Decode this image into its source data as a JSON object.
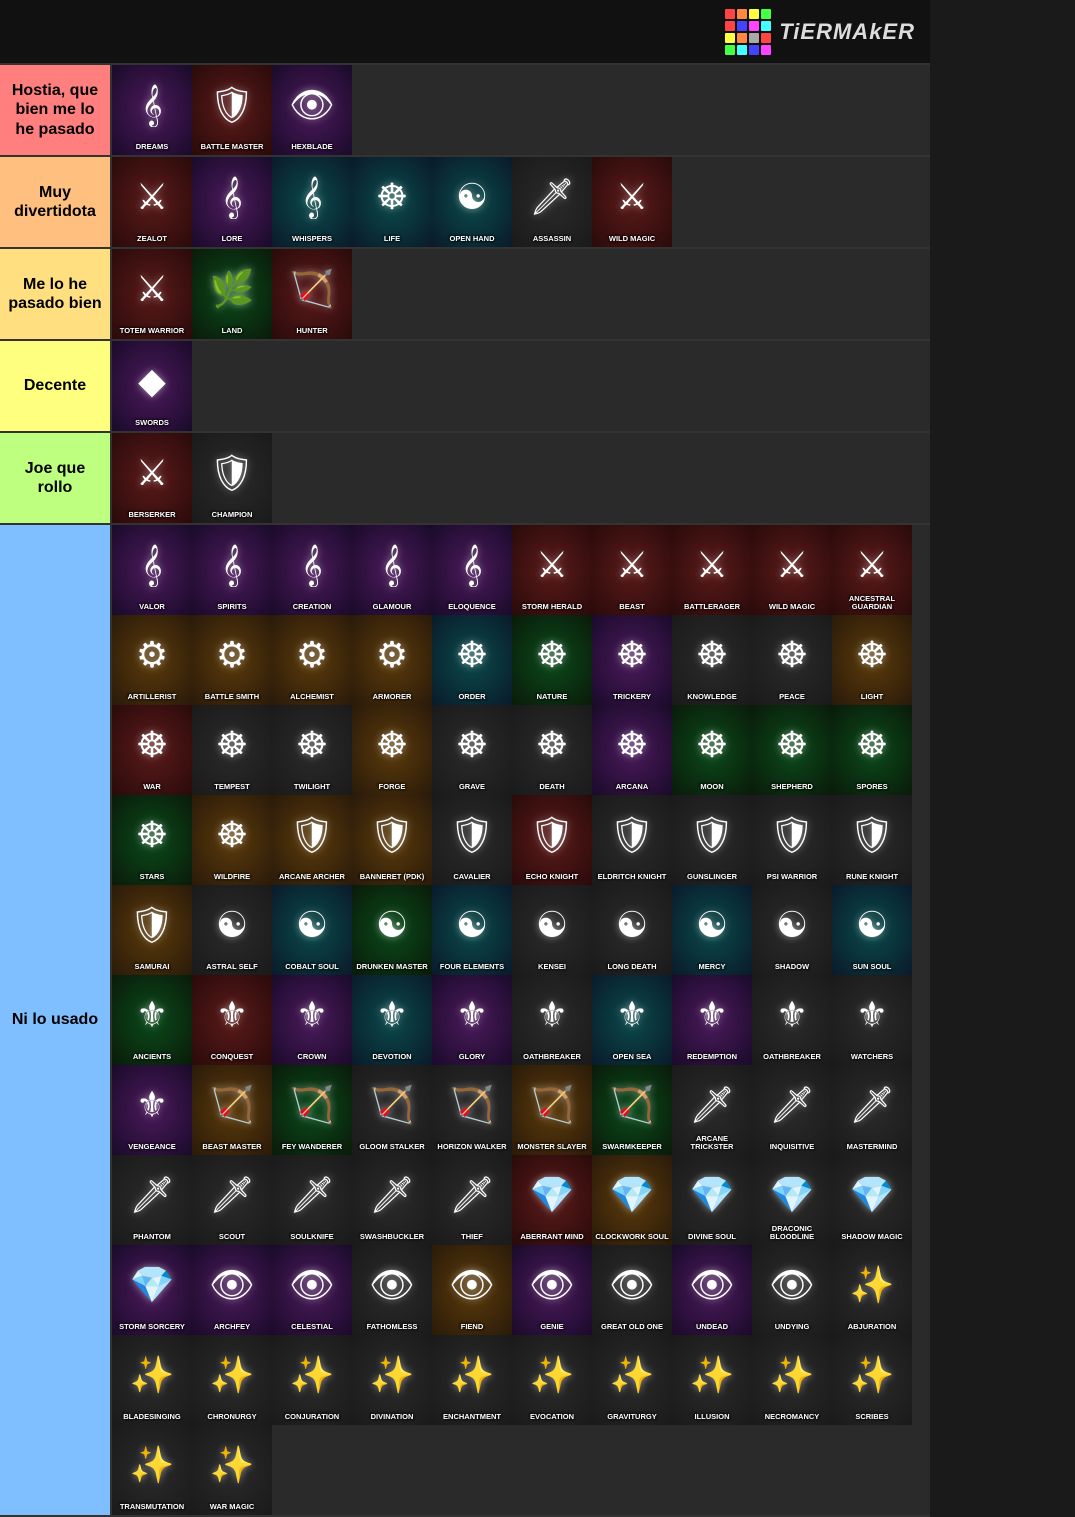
{
  "header": {
    "logo_text": "TiERMAkER",
    "logo_colors": [
      "#f44",
      "#f84",
      "#4f4",
      "#44f",
      "#ff4",
      "#4ff",
      "#f4f",
      "#fff",
      "#f44",
      "#4f4",
      "#44f",
      "#ff4",
      "#f84",
      "#4ff",
      "#f4f",
      "#aaa"
    ]
  },
  "tiers": [
    {
      "id": "s",
      "label": "Hostia, que bien me lo he pasado",
      "color": "#ff7f7f",
      "items": [
        {
          "name": "Dreams",
          "icon": "🎭",
          "bg": "purple"
        },
        {
          "name": "Battle Master",
          "icon": "⚔",
          "bg": "red"
        },
        {
          "name": "Hexblade",
          "icon": "👁",
          "bg": "purple"
        }
      ]
    },
    {
      "id": "a",
      "label": "Muy divertidota",
      "color": "#ffbf7f",
      "items": [
        {
          "name": "Zealot",
          "icon": "🪓",
          "bg": "red"
        },
        {
          "name": "Lore",
          "icon": "🎵",
          "bg": "purple"
        },
        {
          "name": "Whispers",
          "icon": "🏹",
          "bg": "teal"
        },
        {
          "name": "Life",
          "icon": "✋",
          "bg": "teal"
        },
        {
          "name": "Open Hand",
          "icon": "✋",
          "bg": "teal"
        },
        {
          "name": "Assassin",
          "icon": "✝",
          "bg": "dark"
        },
        {
          "name": "Wild Magic",
          "icon": "💧",
          "bg": "red"
        }
      ]
    },
    {
      "id": "b",
      "label": "Me lo he pasado bien",
      "color": "#ffdf7f",
      "items": [
        {
          "name": "Totem Warrior",
          "icon": "🐺",
          "bg": "red"
        },
        {
          "name": "Land",
          "icon": "🌿",
          "bg": "green"
        },
        {
          "name": "Hunter",
          "icon": "🐾",
          "bg": "red"
        }
      ]
    },
    {
      "id": "c",
      "label": "Decente",
      "color": "#ffff7f",
      "items": [
        {
          "name": "Swords",
          "icon": "🗡",
          "bg": "purple"
        }
      ]
    },
    {
      "id": "d",
      "label": "Joe que rollo",
      "color": "#bfff7f",
      "items": [
        {
          "name": "Berserker",
          "icon": "🪓",
          "bg": "red"
        },
        {
          "name": "Champion",
          "icon": "⚔",
          "bg": "dark"
        }
      ]
    },
    {
      "id": "e",
      "label": "Ni lo usado",
      "color": "#7fbfff",
      "items": [
        {
          "name": "Valor",
          "icon": "🎵",
          "bg": "purple"
        },
        {
          "name": "Spirits",
          "icon": "🎵",
          "bg": "purple"
        },
        {
          "name": "Creation",
          "icon": "🎵",
          "bg": "purple"
        },
        {
          "name": "Glamour",
          "icon": "🎵",
          "bg": "purple"
        },
        {
          "name": "Eloquence",
          "icon": "🎵",
          "bg": "purple"
        },
        {
          "name": "Storm Herald",
          "icon": "🪓",
          "bg": "red"
        },
        {
          "name": "Beast",
          "icon": "🪓",
          "bg": "red"
        },
        {
          "name": "Battlerager",
          "icon": "🪓",
          "bg": "red"
        },
        {
          "name": "Wild Magic",
          "icon": "🪓",
          "bg": "red"
        },
        {
          "name": "Ancestral Guardian",
          "icon": "🪓",
          "bg": "red"
        },
        {
          "name": "Artillerist",
          "icon": "⚙",
          "bg": "orange"
        },
        {
          "name": "Battle Smith",
          "icon": "⚙",
          "bg": "orange"
        },
        {
          "name": "Alchemist",
          "icon": "⚙",
          "bg": "orange"
        },
        {
          "name": "Armorer",
          "icon": "⚙",
          "bg": "orange"
        },
        {
          "name": "Order",
          "icon": "☸",
          "bg": "teal"
        },
        {
          "name": "Nature",
          "icon": "☸",
          "bg": "green"
        },
        {
          "name": "Trickery",
          "icon": "☸",
          "bg": "purple"
        },
        {
          "name": "Knowledge",
          "icon": "☸",
          "bg": "dark"
        },
        {
          "name": "Peace",
          "icon": "☸",
          "bg": "dark"
        },
        {
          "name": "Light",
          "icon": "☸",
          "bg": "orange"
        },
        {
          "name": "War",
          "icon": "☸",
          "bg": "red"
        },
        {
          "name": "Tempest",
          "icon": "☸",
          "bg": "dark"
        },
        {
          "name": "Twilight",
          "icon": "☸",
          "bg": "dark"
        },
        {
          "name": "Forge",
          "icon": "☸",
          "bg": "orange"
        },
        {
          "name": "Grave",
          "icon": "☸",
          "bg": "dark"
        },
        {
          "name": "Death",
          "icon": "☸",
          "bg": "dark"
        },
        {
          "name": "Arcana",
          "icon": "☸",
          "bg": "purple"
        },
        {
          "name": "Moon",
          "icon": "☸",
          "bg": "green"
        },
        {
          "name": "Shepherd",
          "icon": "☸",
          "bg": "green"
        },
        {
          "name": "Spores",
          "icon": "☸",
          "bg": "green"
        },
        {
          "name": "Stars",
          "icon": "⚔",
          "bg": "green"
        },
        {
          "name": "Wildfire",
          "icon": "⚔",
          "bg": "orange"
        },
        {
          "name": "Arcane Archer",
          "icon": "🏹",
          "bg": "orange"
        },
        {
          "name": "Banneret (PDK)",
          "icon": "🏹",
          "bg": "orange"
        },
        {
          "name": "Cavalier",
          "icon": "🏹",
          "bg": "dark"
        },
        {
          "name": "Echo Knight",
          "icon": "🏹",
          "bg": "red"
        },
        {
          "name": "Eldritch Knight",
          "icon": "🏹",
          "bg": "dark"
        },
        {
          "name": "Gunslinger",
          "icon": "🏹",
          "bg": "dark"
        },
        {
          "name": "Psi Warrior",
          "icon": "🏹",
          "bg": "dark"
        },
        {
          "name": "Rune Knight",
          "icon": "🏹",
          "bg": "dark"
        },
        {
          "name": "Samurai",
          "icon": "🪓",
          "bg": "orange"
        },
        {
          "name": "Astral Self",
          "icon": "✋",
          "bg": "dark"
        },
        {
          "name": "Cobalt Soul",
          "icon": "✋",
          "bg": "teal"
        },
        {
          "name": "Drunken Master",
          "icon": "✋",
          "bg": "green"
        },
        {
          "name": "Four Elements",
          "icon": "✋",
          "bg": "teal"
        },
        {
          "name": "Kensei",
          "icon": "✋",
          "bg": "dark"
        },
        {
          "name": "Long Death",
          "icon": "✋",
          "bg": "dark"
        },
        {
          "name": "Mercy",
          "icon": "✋",
          "bg": "teal"
        },
        {
          "name": "Shadow",
          "icon": "✋",
          "bg": "dark"
        },
        {
          "name": "Sun Soul",
          "icon": "✋",
          "bg": "teal"
        },
        {
          "name": "Ancients",
          "icon": "⚜",
          "bg": "green"
        },
        {
          "name": "Conquest",
          "icon": "⚜",
          "bg": "red"
        },
        {
          "name": "Crown",
          "icon": "⚜",
          "bg": "purple"
        },
        {
          "name": "Devotion",
          "icon": "⚜",
          "bg": "teal"
        },
        {
          "name": "Glory",
          "icon": "⚜",
          "bg": "purple"
        },
        {
          "name": "Oathbreaker",
          "icon": "⚜",
          "bg": "dark"
        },
        {
          "name": "Open Sea",
          "icon": "⚜",
          "bg": "teal"
        },
        {
          "name": "Redemption",
          "icon": "⚜",
          "bg": "purple"
        },
        {
          "name": "Oathbreaker",
          "icon": "⚜",
          "bg": "dark"
        },
        {
          "name": "Watchers",
          "icon": "⚜",
          "bg": "dark"
        },
        {
          "name": "Vengeance",
          "icon": "⚜",
          "bg": "purple"
        },
        {
          "name": "Beast Master",
          "icon": "✕",
          "bg": "orange"
        },
        {
          "name": "Fey Wanderer",
          "icon": "✕",
          "bg": "green"
        },
        {
          "name": "Gloom Stalker",
          "icon": "✕",
          "bg": "dark"
        },
        {
          "name": "Horizon Walker",
          "icon": "✕",
          "bg": "dark"
        },
        {
          "name": "Monster Slayer",
          "icon": "✕",
          "bg": "orange"
        },
        {
          "name": "Swarmkeeper",
          "icon": "✕",
          "bg": "green"
        },
        {
          "name": "Arcane Trickster",
          "icon": "✝",
          "bg": "dark"
        },
        {
          "name": "Inquisitive",
          "icon": "✝",
          "bg": "dark"
        },
        {
          "name": "Mastermind",
          "icon": "✝",
          "bg": "dark"
        },
        {
          "name": "Phantom",
          "icon": "✝",
          "bg": "dark"
        },
        {
          "name": "Scout",
          "icon": "✝",
          "bg": "dark"
        },
        {
          "name": "Soulknife",
          "icon": "✝",
          "bg": "dark"
        },
        {
          "name": "Swashbuckler",
          "icon": "✝",
          "bg": "dark"
        },
        {
          "name": "Thief",
          "icon": "✝",
          "bg": "dark"
        },
        {
          "name": "Aberrant Mind",
          "icon": "💧",
          "bg": "red"
        },
        {
          "name": "Clockwork Soul",
          "icon": "💧",
          "bg": "orange"
        },
        {
          "name": "Divine Soul",
          "icon": "💧",
          "bg": "dark"
        },
        {
          "name": "Draconic Bloodline",
          "icon": "💧",
          "bg": "dark"
        },
        {
          "name": "Shadow Magic",
          "icon": "💧",
          "bg": "dark"
        },
        {
          "name": "Storm Sorcery",
          "icon": "💧",
          "bg": "purple"
        },
        {
          "name": "Archfey",
          "icon": "⚙",
          "bg": "purple"
        },
        {
          "name": "Celestial",
          "icon": "⚙",
          "bg": "purple"
        },
        {
          "name": "Fathomless",
          "icon": "👁",
          "bg": "dark"
        },
        {
          "name": "Fiend",
          "icon": "👁",
          "bg": "orange"
        },
        {
          "name": "Genie",
          "icon": "👁",
          "bg": "purple"
        },
        {
          "name": "Great Old One",
          "icon": "👁",
          "bg": "dark"
        },
        {
          "name": "Undead",
          "icon": "👁",
          "bg": "purple"
        },
        {
          "name": "Undying",
          "icon": "👁",
          "bg": "dark"
        },
        {
          "name": "Abjuration",
          "icon": "🌀",
          "bg": "dark"
        },
        {
          "name": "Bladesinging",
          "icon": "🌀",
          "bg": "dark"
        },
        {
          "name": "Chronurgy",
          "icon": "🌀",
          "bg": "dark"
        },
        {
          "name": "Conjuration",
          "icon": "🌀",
          "bg": "dark"
        },
        {
          "name": "Divination",
          "icon": "🌀",
          "bg": "dark"
        },
        {
          "name": "Enchantment",
          "icon": "🌀",
          "bg": "dark"
        },
        {
          "name": "Evocation",
          "icon": "🌀",
          "bg": "dark"
        },
        {
          "name": "Graviturgy",
          "icon": "🌀",
          "bg": "dark"
        },
        {
          "name": "Illusion",
          "icon": "🌀",
          "bg": "dark"
        },
        {
          "name": "Necromancy",
          "icon": "🌀",
          "bg": "dark"
        },
        {
          "name": "Scribes",
          "icon": "🌀",
          "bg": "dark"
        },
        {
          "name": "Transmutation",
          "icon": "🌀",
          "bg": "dark"
        },
        {
          "name": "War Magic",
          "icon": "🌀",
          "bg": "dark"
        }
      ]
    }
  ]
}
